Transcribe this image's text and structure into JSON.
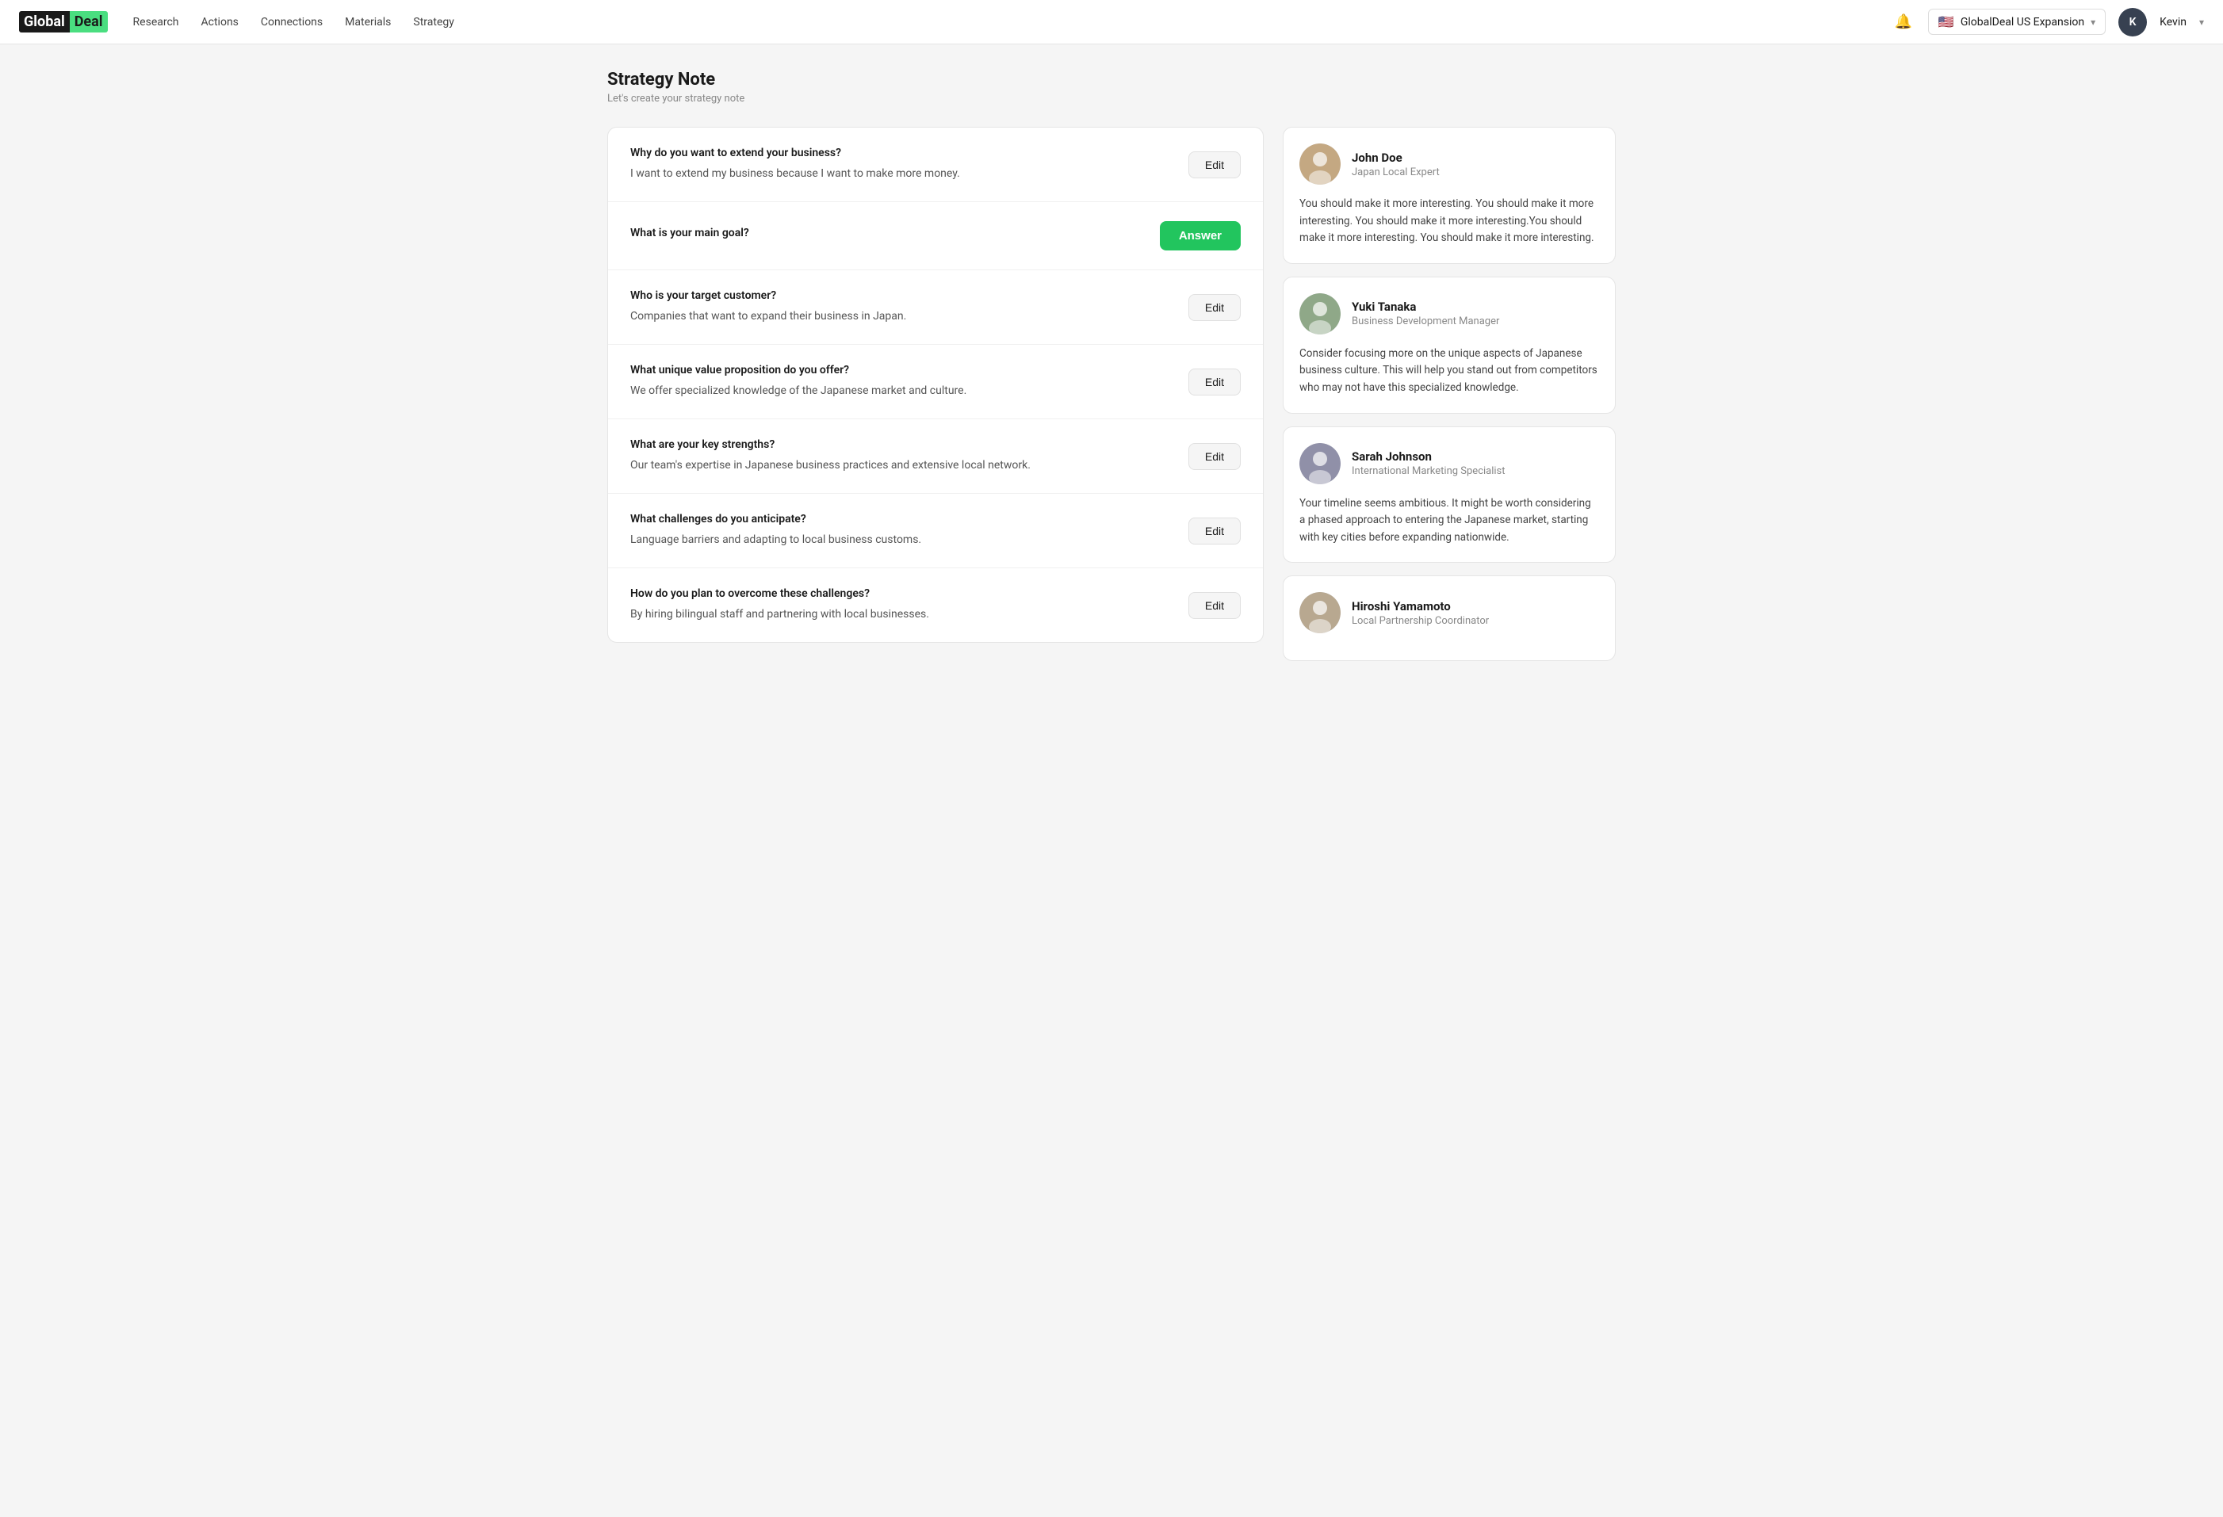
{
  "brand": {
    "logo_global": "Global",
    "logo_deal": "Deal"
  },
  "nav": {
    "links": [
      {
        "id": "research",
        "label": "Research"
      },
      {
        "id": "actions",
        "label": "Actions"
      },
      {
        "id": "connections",
        "label": "Connections"
      },
      {
        "id": "materials",
        "label": "Materials"
      },
      {
        "id": "strategy",
        "label": "Strategy"
      }
    ]
  },
  "workspace": {
    "flag": "🇺🇸",
    "name": "GlobalDeal US Expansion"
  },
  "user": {
    "initial": "K",
    "name": "Kevin"
  },
  "page": {
    "title": "Strategy Note",
    "subtitle": "Let's create your strategy note"
  },
  "questions": [
    {
      "id": "q1",
      "label": "Why do you want to extend your business?",
      "answer": "I want to extend my business because I want to make more money.",
      "action": "edit",
      "action_label": "Edit"
    },
    {
      "id": "q2",
      "label": "What is your main goal?",
      "answer": "",
      "action": "answer",
      "action_label": "Answer"
    },
    {
      "id": "q3",
      "label": "Who is your target customer?",
      "answer": "Companies that want to expand their business in Japan.",
      "action": "edit",
      "action_label": "Edit"
    },
    {
      "id": "q4",
      "label": "What unique value proposition do you offer?",
      "answer": "We offer specialized knowledge of the Japanese market and culture.",
      "action": "edit",
      "action_label": "Edit"
    },
    {
      "id": "q5",
      "label": "What are your key strengths?",
      "answer": "Our team's expertise in Japanese business practices and extensive local network.",
      "action": "edit",
      "action_label": "Edit"
    },
    {
      "id": "q6",
      "label": "What challenges do you anticipate?",
      "answer": "Language barriers and adapting to local business customs.",
      "action": "edit",
      "action_label": "Edit"
    },
    {
      "id": "q7",
      "label": "How do you plan to overcome these challenges?",
      "answer": "By hiring bilingual staff and partnering with local businesses.",
      "action": "edit",
      "action_label": "Edit"
    }
  ],
  "advisors": [
    {
      "id": "a1",
      "name": "John Doe",
      "role": "Japan Local Expert",
      "comment": "You should make it more interesting. You should make it more interesting. You should make it more interesting.You should make it more interesting. You should make it more interesting.",
      "face_color": "#c4a882"
    },
    {
      "id": "a2",
      "name": "Yuki Tanaka",
      "role": "Business Development Manager",
      "comment": "Consider focusing more on the unique aspects of Japanese business culture. This will help you stand out from competitors who may not have this specialized knowledge.",
      "face_color": "#8fa888"
    },
    {
      "id": "a3",
      "name": "Sarah Johnson",
      "role": "International Marketing Specialist",
      "comment": "Your timeline seems ambitious. It might be worth considering a phased approach to entering the Japanese market, starting with key cities before expanding nationwide.",
      "face_color": "#9090a8"
    },
    {
      "id": "a4",
      "name": "Hiroshi Yamamoto",
      "role": "Local Partnership Coordinator",
      "comment": "",
      "face_color": "#b8a890"
    }
  ]
}
